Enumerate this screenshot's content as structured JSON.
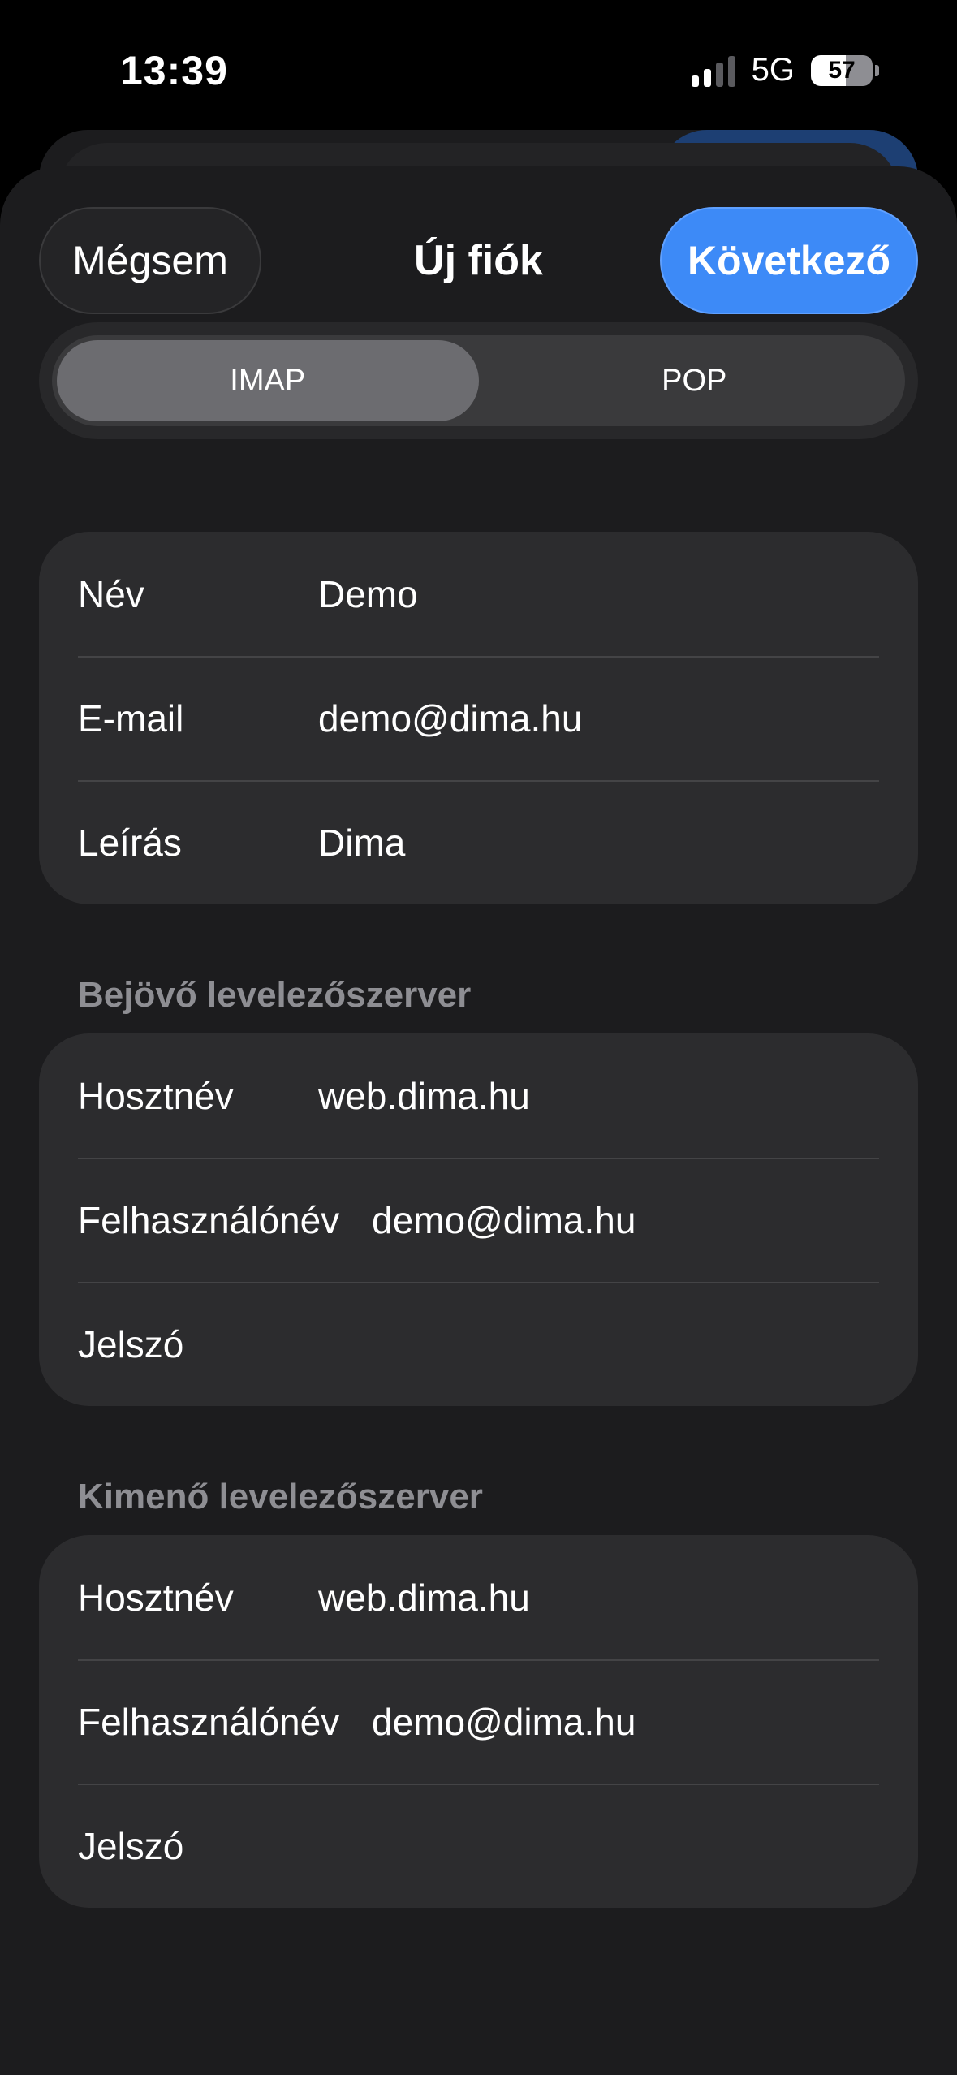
{
  "status_bar": {
    "time": "13:39",
    "network": "5G",
    "battery": "57",
    "battery_level": 0.57
  },
  "nav": {
    "cancel_label": "Mégsem",
    "title": "Új fiók",
    "next_label": "Következő"
  },
  "segment": {
    "options": [
      "IMAP",
      "POP"
    ],
    "selected": "IMAP"
  },
  "account": {
    "rows": [
      {
        "label": "Név",
        "value": "Demo"
      },
      {
        "label": "E-mail",
        "value": "demo@dima.hu"
      },
      {
        "label": "Leírás",
        "value": "Dima"
      }
    ]
  },
  "incoming": {
    "header": "Bejövő levelezőszerver",
    "rows": [
      {
        "label": "Hosztnév",
        "value": "web.dima.hu"
      },
      {
        "label": "Felhasználónév",
        "value": "demo@dima.hu"
      },
      {
        "label": "Jelszó",
        "value": ""
      }
    ]
  },
  "outgoing": {
    "header": "Kimenő levelezőszerver",
    "rows": [
      {
        "label": "Hosztnév",
        "value": "web.dima.hu"
      },
      {
        "label": "Felhasználónév",
        "value": "demo@dima.hu"
      },
      {
        "label": "Jelszó",
        "value": ""
      }
    ]
  },
  "colors": {
    "accent": "#3d8af7",
    "sheet": "#1c1c1e",
    "group": "#2c2c2e",
    "secondary_text": "#8e8e93"
  }
}
